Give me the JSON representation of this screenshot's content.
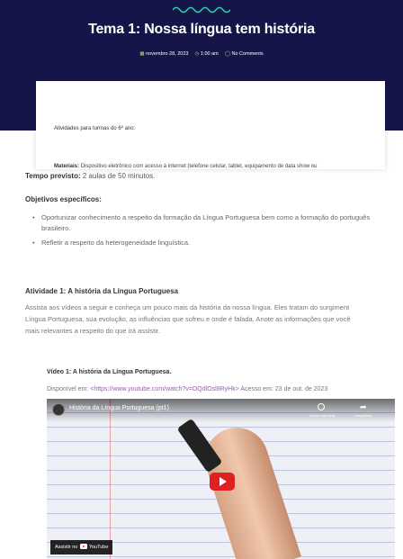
{
  "post": {
    "title": "Tema 1: Nossa língua tem história",
    "date": "novembro 28, 2023",
    "time": "1:00 am",
    "comments": "No Comments"
  },
  "card": {
    "activities_heading": "Atividades para turmas do 6º ano:",
    "materials_label": "Materiais:",
    "materials_text": "Dispositivo eletrônico com acesso à internet (telefone celular, tablet, equipamento de data show ou"
  },
  "tempo": {
    "label": "Tempo previsto:",
    "text": "2 aulas de 50 minutos."
  },
  "objectives": {
    "heading": "Objetivos específicos:",
    "items": [
      "Oportunizar conhecimento a respeito da formação da Língua Portuguesa bem como a formação do português brasileiro.",
      "Refletir a respeito da heterogeneidade linguística."
    ]
  },
  "activity1": {
    "heading": "Atividade 1: A história da Língua Portuguesa",
    "lines": [
      "Assista aos vídeos a seguir e conheça um pouco mais da história da nossa língua. Eles tratam do surgiment",
      "Língua Portuguesa, sua evolução, as influências que sofreu e onde é falada. Anote as informações que você",
      "mais relevantes a respeito do que irá assistir."
    ]
  },
  "video1": {
    "heading": "Vídeo 1: A história da Língua Portuguesa.",
    "available_label": "Disponível em:",
    "url": "<https://www.youtube.com/watch?v=OQdlOsl8RyHk>",
    "accessed": "Acesso em: 23 de out. de 2023",
    "player_title": "História da Língua Portuguesa (pt1)",
    "watch_later": "Assistir mais tarde",
    "share": "Compartilhar",
    "watch_on": "Assistir no",
    "youtube": "YouTube"
  },
  "colors": {
    "hero_bg": "#15154a",
    "accent_green": "#b9d86a",
    "link_purple": "#9b59b6",
    "play_red": "#e02020"
  },
  "icons": [
    "squiggle-icon",
    "calendar-icon",
    "clock-icon",
    "comment-icon",
    "play-icon",
    "share-icon",
    "youtube-logo-icon"
  ]
}
